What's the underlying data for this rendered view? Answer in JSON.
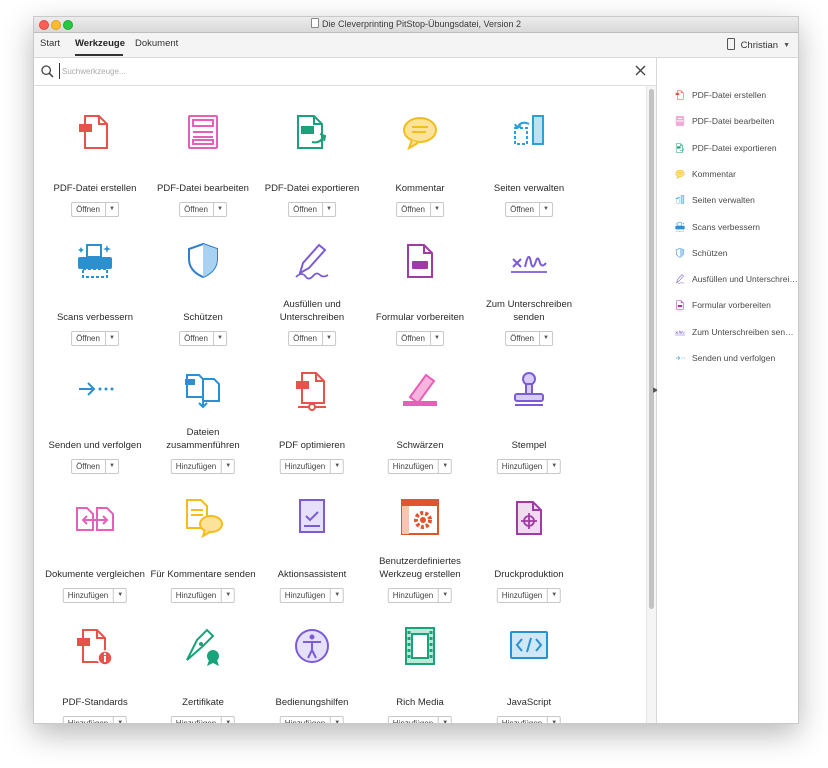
{
  "window": {
    "title": "Die Cleverprinting PitStop-Übungsdatei, Version 2"
  },
  "menu": {
    "tabs": [
      "Start",
      "Werkzeuge",
      "Dokument"
    ],
    "active_tab": "Werkzeuge",
    "user": "Christian"
  },
  "search": {
    "placeholder": "Suchwerkzeuge..."
  },
  "tools": [
    {
      "label": "PDF-Datei erstellen",
      "button": "Öffnen",
      "icon": "create-pdf-icon"
    },
    {
      "label": "PDF-Datei bearbeiten",
      "button": "Öffnen",
      "icon": "edit-pdf-icon"
    },
    {
      "label": "PDF-Datei exportieren",
      "button": "Öffnen",
      "icon": "export-pdf-icon"
    },
    {
      "label": "Kommentar",
      "button": "Öffnen",
      "icon": "comment-icon"
    },
    {
      "label": "Seiten verwalten",
      "button": "Öffnen",
      "icon": "organize-pages-icon"
    },
    {
      "label": "Scans verbessern",
      "button": "Öffnen",
      "icon": "enhance-scans-icon"
    },
    {
      "label": "Schützen",
      "button": "Öffnen",
      "icon": "protect-icon"
    },
    {
      "label": "Ausfüllen und Unterschreiben",
      "button": "Öffnen",
      "icon": "fill-sign-icon"
    },
    {
      "label": "Formular vorbereiten",
      "button": "Öffnen",
      "icon": "prepare-form-icon"
    },
    {
      "label": "Zum Unterschreiben senden",
      "button": "Öffnen",
      "icon": "send-for-signature-icon"
    },
    {
      "label": "Senden und verfolgen",
      "button": "Öffnen",
      "icon": "send-track-icon"
    },
    {
      "label": "Dateien zusammenführen",
      "button": "Hinzufügen",
      "icon": "combine-files-icon"
    },
    {
      "label": "PDF optimieren",
      "button": "Hinzufügen",
      "icon": "optimize-pdf-icon"
    },
    {
      "label": "Schwärzen",
      "button": "Hinzufügen",
      "icon": "redact-icon"
    },
    {
      "label": "Stempel",
      "button": "Hinzufügen",
      "icon": "stamp-icon"
    },
    {
      "label": "Dokumente vergleichen",
      "button": "Hinzufügen",
      "icon": "compare-documents-icon"
    },
    {
      "label": "Für Kommentare senden",
      "button": "Hinzufügen",
      "icon": "send-for-comments-icon"
    },
    {
      "label": "Aktionsassistent",
      "button": "Hinzufügen",
      "icon": "action-wizard-icon"
    },
    {
      "label": "Benutzerdefiniertes Werkzeug erstellen",
      "button": "Hinzufügen",
      "icon": "custom-tool-icon"
    },
    {
      "label": "Druckproduktion",
      "button": "Hinzufügen",
      "icon": "print-production-icon"
    },
    {
      "label": "PDF-Standards",
      "button": "Hinzufügen",
      "icon": "pdf-standards-icon"
    },
    {
      "label": "Zertifikate",
      "button": "Hinzufügen",
      "icon": "certificates-icon"
    },
    {
      "label": "Bedienungshilfen",
      "button": "Hinzufügen",
      "icon": "accessibility-icon"
    },
    {
      "label": "Rich Media",
      "button": "Hinzufügen",
      "icon": "rich-media-icon"
    },
    {
      "label": "JavaScript",
      "button": "Hinzufügen",
      "icon": "javascript-icon"
    }
  ],
  "right_panel": [
    {
      "label": "PDF-Datei erstellen",
      "icon": "create-pdf-icon"
    },
    {
      "label": "PDF-Datei bearbeiten",
      "icon": "edit-pdf-icon"
    },
    {
      "label": "PDF-Datei exportieren",
      "icon": "export-pdf-icon"
    },
    {
      "label": "Kommentar",
      "icon": "comment-icon"
    },
    {
      "label": "Seiten verwalten",
      "icon": "organize-pages-icon"
    },
    {
      "label": "Scans verbessern",
      "icon": "enhance-scans-icon"
    },
    {
      "label": "Schützen",
      "icon": "protect-icon"
    },
    {
      "label": "Ausfüllen und Unterschreiben",
      "icon": "fill-sign-icon"
    },
    {
      "label": "Formular vorbereiten",
      "icon": "prepare-form-icon"
    },
    {
      "label": "Zum Unterschreiben senden",
      "icon": "send-for-signature-icon"
    },
    {
      "label": "Senden und verfolgen",
      "icon": "send-track-icon"
    }
  ],
  "colors": {
    "create": "#e5534b",
    "edit": "#e660b8",
    "export": "#1aa37a",
    "comment": "#f2bd1d",
    "organize": "#2ea0d8",
    "scan": "#2b8fd0",
    "protect": "#2b7fcf",
    "sign": "#7b5cd6",
    "form": "#a23aa6",
    "redact": "#e660b8",
    "stamp": "#7b5cd6",
    "custom": "#e0562c"
  }
}
